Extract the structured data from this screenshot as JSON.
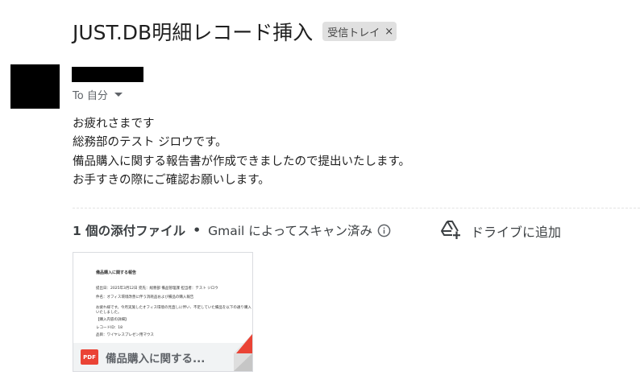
{
  "email": {
    "subject": "JUST.DB明細レコード挿入",
    "label": "受信トレイ",
    "label_remove": "×",
    "recipient_label": "To 自分",
    "body_lines": [
      "お疲れさまです",
      "総務部のテスト ジロウです。",
      "備品購入に関する報告書が作成できましたので提出いたします。",
      "お手すきの際にご確認お願いします。"
    ]
  },
  "attachments": {
    "count_label": "1 個の添付ファイル",
    "separator": "•",
    "scan_label": "Gmail によってスキャン済み",
    "drive_action": "ドライブに追加",
    "items": [
      {
        "file_type": "PDF",
        "file_name": "備品購入に関する...",
        "preview_lines": [
          "備品購入に関する報告",
          "提出日：2025年3月12日 宛先：総務部 備品管理課 担当者：テスト ジロウ",
          "件名：オフィス環境改善に伴う消耗品および備品の購入報告",
          "お疲れ様です。今月実施したオフィス環境の見直しに伴い、不足していた備品を以下の通り購入",
          "いたしました。",
          "【購入内容の詳細】",
          "レコードID：18",
          "品目：ワイヤレスプレゼン用マウス"
        ]
      }
    ]
  },
  "icons": {
    "info": "info-circle-icon",
    "drive_add": "drive-add-icon",
    "dropdown": "caret-down-icon",
    "pdf": "pdf-icon"
  },
  "colors": {
    "pdf_red": "#ea4335",
    "label_bg": "#e0e0e0",
    "muted_text": "#5f6368"
  }
}
